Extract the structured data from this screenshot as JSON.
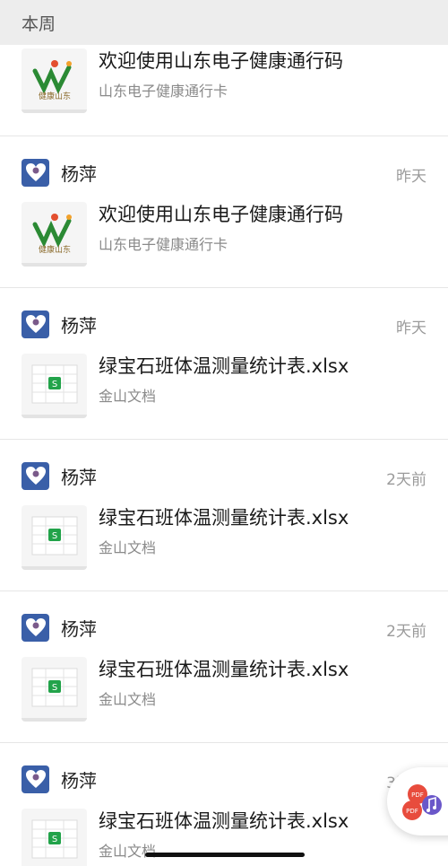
{
  "section": {
    "title": "本周"
  },
  "entries": [
    {
      "card": {
        "title": "欢迎使用山东电子健康通行码",
        "source": "山东电子健康通行卡",
        "thumb_icon": "health-pass-logo-icon",
        "thumb_text": "健康山东"
      }
    },
    {
      "sender": {
        "name": "杨萍",
        "avatar_icon": "heart-avatar-icon"
      },
      "time": "昨天",
      "card": {
        "title": "欢迎使用山东电子健康通行码",
        "source": "山东电子健康通行卡",
        "thumb_icon": "health-pass-logo-icon",
        "thumb_text": "健康山东"
      }
    },
    {
      "sender": {
        "name": "杨萍",
        "avatar_icon": "heart-avatar-icon"
      },
      "time": "昨天",
      "card": {
        "title": "绿宝石班体温测量统计表.xlsx",
        "source": "金山文档",
        "thumb_icon": "spreadsheet-icon",
        "thumb_text": "S"
      }
    },
    {
      "sender": {
        "name": "杨萍",
        "avatar_icon": "heart-avatar-icon"
      },
      "time": "2天前",
      "card": {
        "title": "绿宝石班体温测量统计表.xlsx",
        "source": "金山文档",
        "thumb_icon": "spreadsheet-icon",
        "thumb_text": "S"
      }
    },
    {
      "sender": {
        "name": "杨萍",
        "avatar_icon": "heart-avatar-icon"
      },
      "time": "2天前",
      "card": {
        "title": "绿宝石班体温测量统计表.xlsx",
        "source": "金山文档",
        "thumb_icon": "spreadsheet-icon",
        "thumb_text": "S"
      }
    },
    {
      "sender": {
        "name": "杨萍",
        "avatar_icon": "heart-avatar-icon"
      },
      "time": "3天前",
      "card": {
        "title": "绿宝石班体温测量统计表.xlsx",
        "source": "金山文档",
        "thumb_icon": "spreadsheet-icon",
        "thumb_text": "S"
      }
    }
  ],
  "floating_button": {
    "icon": "pdf-music-icon",
    "label_1": "PDF",
    "label_2": "PDF"
  },
  "colors": {
    "header_bg": "#ededed",
    "avatar_bg": "#3a5fa8",
    "sheet_green": "#22a34a"
  }
}
